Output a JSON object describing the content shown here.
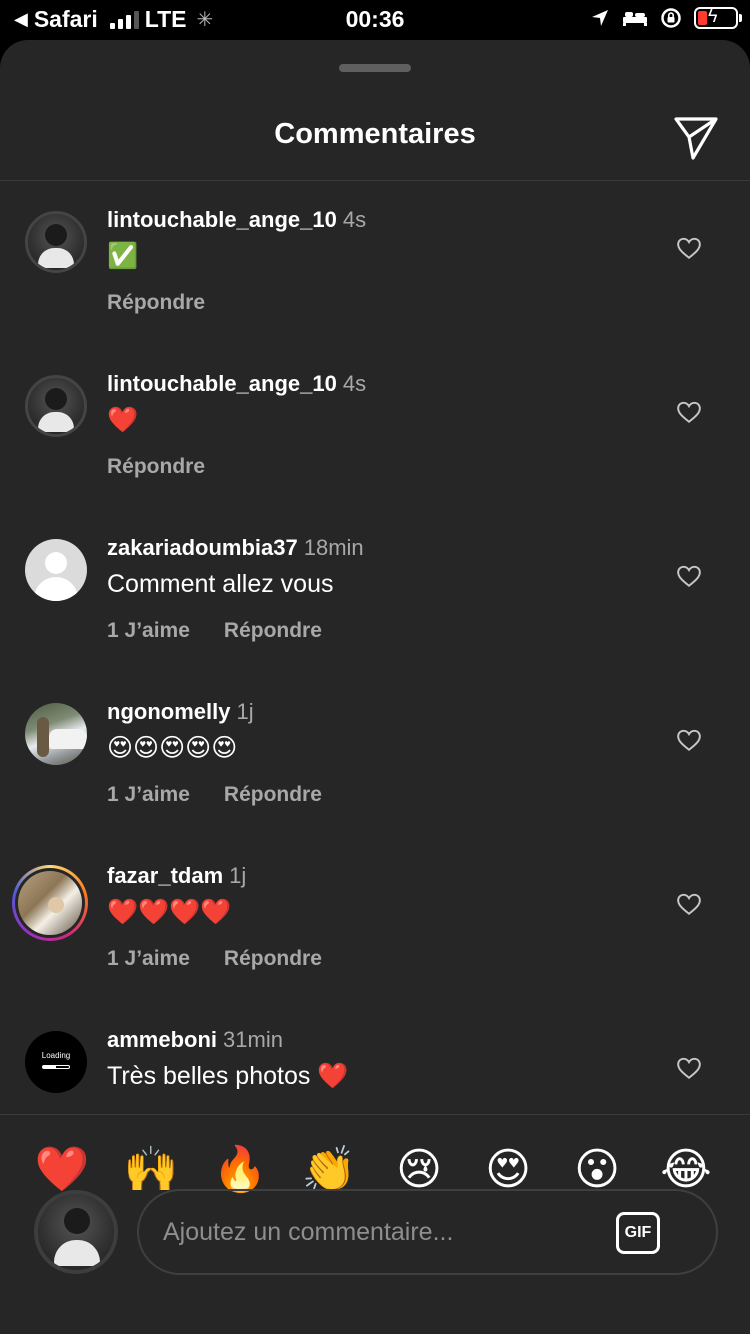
{
  "status_bar": {
    "back_app": "Safari",
    "network": "LTE",
    "time": "00:36",
    "battery_color": "#ff3b30"
  },
  "sheet": {
    "title": "Commentaires"
  },
  "comments": [
    {
      "username": "lintouchable_ange_10",
      "time": "4s",
      "text": "✅",
      "likes": "",
      "reply": "Répondre"
    },
    {
      "username": "lintouchable_ange_10",
      "time": "4s",
      "text": "❤️",
      "likes": "",
      "reply": "Répondre"
    },
    {
      "username": "zakariadoumbia37",
      "time": "18min",
      "text": "Comment allez vous",
      "likes": "1 J’aime",
      "reply": "Répondre"
    },
    {
      "username": "ngonomelly",
      "time": "1j",
      "text": "😍😍😍😍😍",
      "likes": "1 J’aime",
      "reply": "Répondre"
    },
    {
      "username": "fazar_tdam",
      "time": "1j",
      "text": "❤️❤️❤️❤️",
      "likes": "1 J’aime",
      "reply": "Répondre"
    },
    {
      "username": "ammeboni",
      "time": "31min",
      "text": "Très belles photos ❤️",
      "likes": "",
      "reply": ""
    }
  ],
  "avatar_loading_text": "Loading",
  "quick_reactions": [
    "❤️",
    "🙌",
    "🔥",
    "👏",
    "😢",
    "😍",
    "😮",
    "😂"
  ],
  "composer": {
    "placeholder": "Ajoutez un commentaire...",
    "gif_label": "GIF"
  }
}
